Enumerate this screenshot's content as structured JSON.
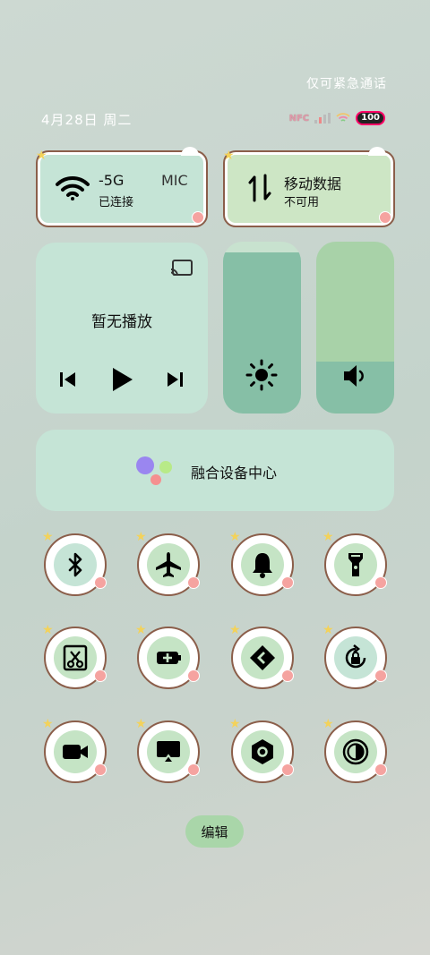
{
  "status": {
    "emergency_only": "仅可紧急通话",
    "date": "4月28日 周二",
    "nfc": "NFC",
    "battery": "100"
  },
  "wifi": {
    "name": "-5G",
    "name_extra": "MIC",
    "status": "已连接"
  },
  "mobile_data": {
    "title": "移动数据",
    "status": "不可用"
  },
  "media": {
    "title": "暂无播放"
  },
  "sliders": {
    "brightness": 0.94,
    "volume": 0.3
  },
  "fusion": {
    "label": "融合设备中心"
  },
  "edit": {
    "label": "编辑"
  },
  "tiles": [
    {
      "icon": "bluetooth-icon",
      "bg": "#c5e4d6"
    },
    {
      "icon": "airplane-icon",
      "bg": "#c5e4c5"
    },
    {
      "icon": "bell-icon",
      "bg": "#c5e4c5"
    },
    {
      "icon": "flashlight-icon",
      "bg": "#c5e4c5"
    },
    {
      "icon": "screenshot-scissors-icon",
      "bg": "#c5e4c5"
    },
    {
      "icon": "battery-saver-icon",
      "bg": "#c5e4c5"
    },
    {
      "icon": "share-icon",
      "bg": "#c5e4c5"
    },
    {
      "icon": "rotation-lock-icon",
      "bg": "#c5e4d6"
    },
    {
      "icon": "screen-record-icon",
      "bg": "#c5e4c5"
    },
    {
      "icon": "screen-cast-icon",
      "bg": "#c5e4c5"
    },
    {
      "icon": "settings-hex-icon",
      "bg": "#c5e4c5"
    },
    {
      "icon": "dark-mode-icon",
      "bg": "#c5e4c5"
    }
  ]
}
